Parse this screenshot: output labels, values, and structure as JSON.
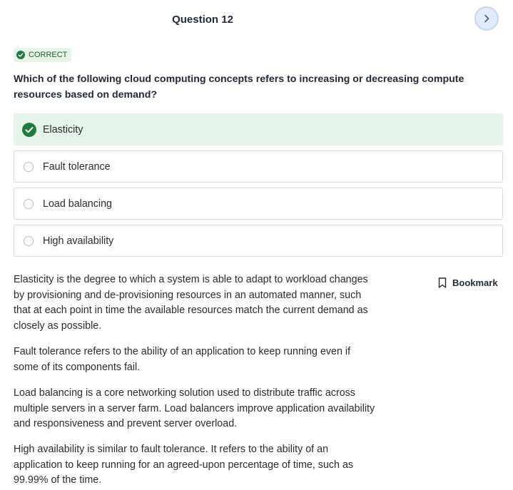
{
  "header": {
    "question_title": "Question 12"
  },
  "status": {
    "badge_label": "CORRECT",
    "accent_color": "#1e7d3a",
    "badge_bg": "#e6f4ea"
  },
  "question": {
    "text": "Which of the following cloud computing concepts refers to increasing or decreasing compute resources based on demand?"
  },
  "options": [
    {
      "label": "Elasticity",
      "state": "correct-selected",
      "icon": "check-circle-icon"
    },
    {
      "label": "Fault tolerance",
      "state": "unselected",
      "icon": "radio-icon"
    },
    {
      "label": "Load balancing",
      "state": "unselected",
      "icon": "radio-icon"
    },
    {
      "label": "High availability",
      "state": "unselected",
      "icon": "radio-icon"
    }
  ],
  "explanations": [
    "Elasticity is the degree to which a system is able to adapt to workload changes by provisioning and de-provisioning resources in an automated manner, such that at each point in time the available resources match the current demand as closely as possible.",
    "Fault tolerance refers to the ability of an application to keep running even if some of its components fail.",
    "Load balancing is a core networking solution used to distribute traffic across multiple servers in a server farm. Load balancers improve application availability and responsiveness and prevent server overload.",
    "High availability is similar to fault tolerance. It refers to the ability of an application to keep running for an agreed-upon percentage of time, such as 99.99% of the time."
  ],
  "bookmark": {
    "label": "Bookmark",
    "icon": "bookmark-icon"
  },
  "navigation": {
    "next_icon": "chevron-right-icon"
  }
}
